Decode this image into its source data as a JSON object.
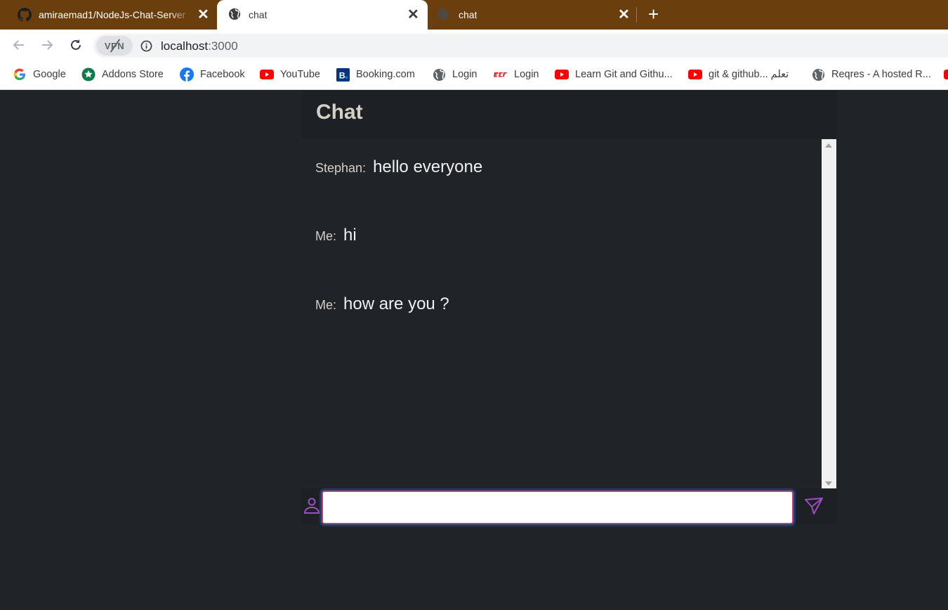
{
  "browser": {
    "tabs": [
      {
        "title": "amiraemad1/NodeJs-Chat-Server",
        "icon": "github-icon",
        "active": false
      },
      {
        "title": "chat",
        "icon": "globe-icon",
        "active": true
      },
      {
        "title": "chat",
        "icon": "globe-icon",
        "active": false
      }
    ],
    "new_tab_label": "+",
    "address": {
      "host": "localhost",
      "port": ":3000"
    },
    "vpn_label": "VPN",
    "bookmarks": [
      {
        "label": "Google",
        "icon": "google-icon"
      },
      {
        "label": "Addons Store",
        "icon": "addons-store-icon"
      },
      {
        "label": "Facebook",
        "icon": "facebook-icon"
      },
      {
        "label": "YouTube",
        "icon": "youtube-icon"
      },
      {
        "label": "Booking.com",
        "icon": "booking-icon"
      },
      {
        "label": "Login",
        "icon": "globe-icon"
      },
      {
        "label": "Login",
        "icon": "login-brand-icon"
      },
      {
        "label": "Learn Git and Githu...",
        "icon": "youtube-icon"
      },
      {
        "label": "git & github... تعلم",
        "icon": "youtube-icon"
      },
      {
        "label": "Reqres - A hosted R...",
        "icon": "globe-icon"
      }
    ]
  },
  "chat": {
    "title": "Chat",
    "messages": [
      {
        "sender": "Stephan:",
        "text": "hello everyone"
      },
      {
        "sender": "Me:",
        "text": "hi"
      },
      {
        "sender": "Me:",
        "text": "how are you ?"
      }
    ],
    "input": {
      "value": "",
      "placeholder": ""
    }
  },
  "colors": {
    "tabstrip": "#6b3f0d",
    "page_background": "#202328",
    "accent_purple": "#9b4fc4",
    "title_text": "#d6cfc3"
  }
}
